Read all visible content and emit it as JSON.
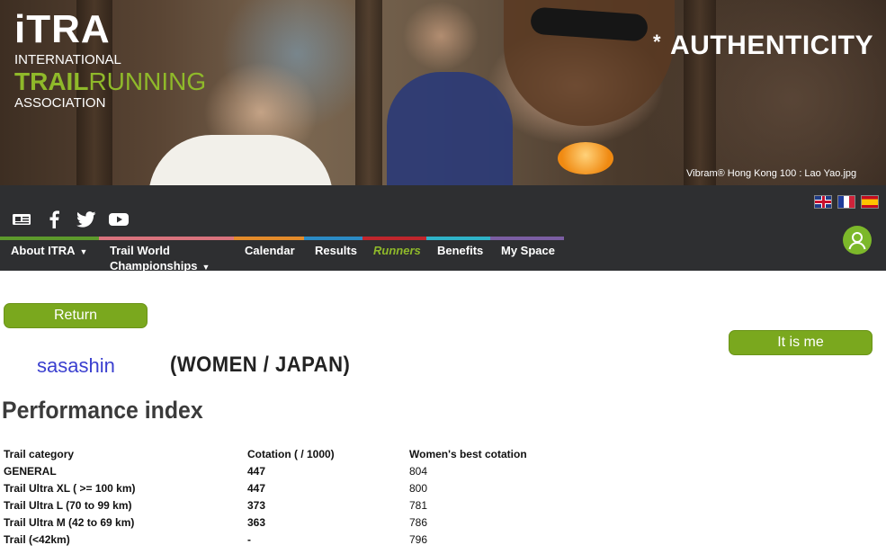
{
  "banner": {
    "logo_mark": "iTRA",
    "logo_line1": "INTERNATIONAL",
    "logo_trail": "TRAIL",
    "logo_running": "RUNNING",
    "logo_line3": "ASSOCIATION",
    "slogan_star": "*",
    "slogan": "AUTHENTICITY",
    "caption": "Vibram® Hong Kong 100 : Lao Yao.jpg"
  },
  "social_icons": [
    "news-icon",
    "facebook-icon",
    "twitter-icon",
    "youtube-icon"
  ],
  "languages": [
    {
      "name": "english-flag-icon"
    },
    {
      "name": "french-flag-icon"
    },
    {
      "name": "spanish-flag-icon"
    }
  ],
  "nav": {
    "about": "About ITRA",
    "trail_world_1": "Trail World",
    "trail_world_2": "Championships",
    "calendar": "Calendar",
    "results": "Results",
    "runners": "Runners",
    "benefits": "Benefits",
    "my_space": "My Space",
    "arrow": "▼"
  },
  "buttons": {
    "return": "Return",
    "it_is_me": "It is me"
  },
  "runner": {
    "name": "sasashin",
    "meta": "(WOMEN / JAPAN)"
  },
  "performance": {
    "title": "Performance index",
    "headers": [
      "Trail category",
      "Cotation ( / 1000)",
      "Women's best cotation"
    ],
    "rows": [
      {
        "category": "GENERAL",
        "cotation": "447",
        "best": "804"
      },
      {
        "category": "Trail Ultra XL ( >= 100 km)",
        "cotation": "447",
        "best": "800"
      },
      {
        "category": "Trail Ultra L (70 to 99 km)",
        "cotation": "373",
        "best": "781"
      },
      {
        "category": "Trail Ultra M (42 to 69 km)",
        "cotation": "363",
        "best": "786"
      },
      {
        "category": "Trail (<42km)",
        "cotation": "-",
        "best": "796"
      }
    ]
  },
  "colors": {
    "brand_green": "#7aa81e",
    "nav_bg": "#2e2f31",
    "name_blue": "#3a3fcf"
  }
}
